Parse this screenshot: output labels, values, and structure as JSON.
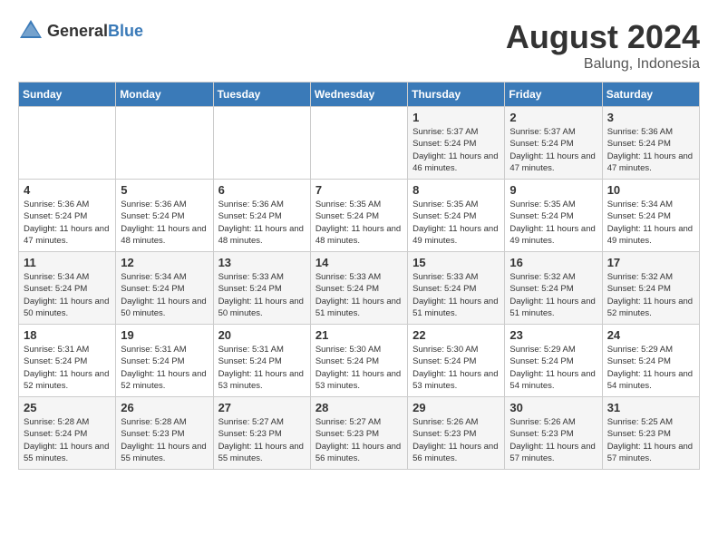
{
  "header": {
    "logo_general": "General",
    "logo_blue": "Blue",
    "month_year": "August 2024",
    "location": "Balung, Indonesia"
  },
  "weekdays": [
    "Sunday",
    "Monday",
    "Tuesday",
    "Wednesday",
    "Thursday",
    "Friday",
    "Saturday"
  ],
  "weeks": [
    [
      {
        "day": "",
        "info": ""
      },
      {
        "day": "",
        "info": ""
      },
      {
        "day": "",
        "info": ""
      },
      {
        "day": "",
        "info": ""
      },
      {
        "day": "1",
        "info": "Sunrise: 5:37 AM\nSunset: 5:24 PM\nDaylight: 11 hours and 46 minutes."
      },
      {
        "day": "2",
        "info": "Sunrise: 5:37 AM\nSunset: 5:24 PM\nDaylight: 11 hours and 47 minutes."
      },
      {
        "day": "3",
        "info": "Sunrise: 5:36 AM\nSunset: 5:24 PM\nDaylight: 11 hours and 47 minutes."
      }
    ],
    [
      {
        "day": "4",
        "info": "Sunrise: 5:36 AM\nSunset: 5:24 PM\nDaylight: 11 hours and 47 minutes."
      },
      {
        "day": "5",
        "info": "Sunrise: 5:36 AM\nSunset: 5:24 PM\nDaylight: 11 hours and 48 minutes."
      },
      {
        "day": "6",
        "info": "Sunrise: 5:36 AM\nSunset: 5:24 PM\nDaylight: 11 hours and 48 minutes."
      },
      {
        "day": "7",
        "info": "Sunrise: 5:35 AM\nSunset: 5:24 PM\nDaylight: 11 hours and 48 minutes."
      },
      {
        "day": "8",
        "info": "Sunrise: 5:35 AM\nSunset: 5:24 PM\nDaylight: 11 hours and 49 minutes."
      },
      {
        "day": "9",
        "info": "Sunrise: 5:35 AM\nSunset: 5:24 PM\nDaylight: 11 hours and 49 minutes."
      },
      {
        "day": "10",
        "info": "Sunrise: 5:34 AM\nSunset: 5:24 PM\nDaylight: 11 hours and 49 minutes."
      }
    ],
    [
      {
        "day": "11",
        "info": "Sunrise: 5:34 AM\nSunset: 5:24 PM\nDaylight: 11 hours and 50 minutes."
      },
      {
        "day": "12",
        "info": "Sunrise: 5:34 AM\nSunset: 5:24 PM\nDaylight: 11 hours and 50 minutes."
      },
      {
        "day": "13",
        "info": "Sunrise: 5:33 AM\nSunset: 5:24 PM\nDaylight: 11 hours and 50 minutes."
      },
      {
        "day": "14",
        "info": "Sunrise: 5:33 AM\nSunset: 5:24 PM\nDaylight: 11 hours and 51 minutes."
      },
      {
        "day": "15",
        "info": "Sunrise: 5:33 AM\nSunset: 5:24 PM\nDaylight: 11 hours and 51 minutes."
      },
      {
        "day": "16",
        "info": "Sunrise: 5:32 AM\nSunset: 5:24 PM\nDaylight: 11 hours and 51 minutes."
      },
      {
        "day": "17",
        "info": "Sunrise: 5:32 AM\nSunset: 5:24 PM\nDaylight: 11 hours and 52 minutes."
      }
    ],
    [
      {
        "day": "18",
        "info": "Sunrise: 5:31 AM\nSunset: 5:24 PM\nDaylight: 11 hours and 52 minutes."
      },
      {
        "day": "19",
        "info": "Sunrise: 5:31 AM\nSunset: 5:24 PM\nDaylight: 11 hours and 52 minutes."
      },
      {
        "day": "20",
        "info": "Sunrise: 5:31 AM\nSunset: 5:24 PM\nDaylight: 11 hours and 53 minutes."
      },
      {
        "day": "21",
        "info": "Sunrise: 5:30 AM\nSunset: 5:24 PM\nDaylight: 11 hours and 53 minutes."
      },
      {
        "day": "22",
        "info": "Sunrise: 5:30 AM\nSunset: 5:24 PM\nDaylight: 11 hours and 53 minutes."
      },
      {
        "day": "23",
        "info": "Sunrise: 5:29 AM\nSunset: 5:24 PM\nDaylight: 11 hours and 54 minutes."
      },
      {
        "day": "24",
        "info": "Sunrise: 5:29 AM\nSunset: 5:24 PM\nDaylight: 11 hours and 54 minutes."
      }
    ],
    [
      {
        "day": "25",
        "info": "Sunrise: 5:28 AM\nSunset: 5:24 PM\nDaylight: 11 hours and 55 minutes."
      },
      {
        "day": "26",
        "info": "Sunrise: 5:28 AM\nSunset: 5:23 PM\nDaylight: 11 hours and 55 minutes."
      },
      {
        "day": "27",
        "info": "Sunrise: 5:27 AM\nSunset: 5:23 PM\nDaylight: 11 hours and 55 minutes."
      },
      {
        "day": "28",
        "info": "Sunrise: 5:27 AM\nSunset: 5:23 PM\nDaylight: 11 hours and 56 minutes."
      },
      {
        "day": "29",
        "info": "Sunrise: 5:26 AM\nSunset: 5:23 PM\nDaylight: 11 hours and 56 minutes."
      },
      {
        "day": "30",
        "info": "Sunrise: 5:26 AM\nSunset: 5:23 PM\nDaylight: 11 hours and 57 minutes."
      },
      {
        "day": "31",
        "info": "Sunrise: 5:25 AM\nSunset: 5:23 PM\nDaylight: 11 hours and 57 minutes."
      }
    ]
  ]
}
